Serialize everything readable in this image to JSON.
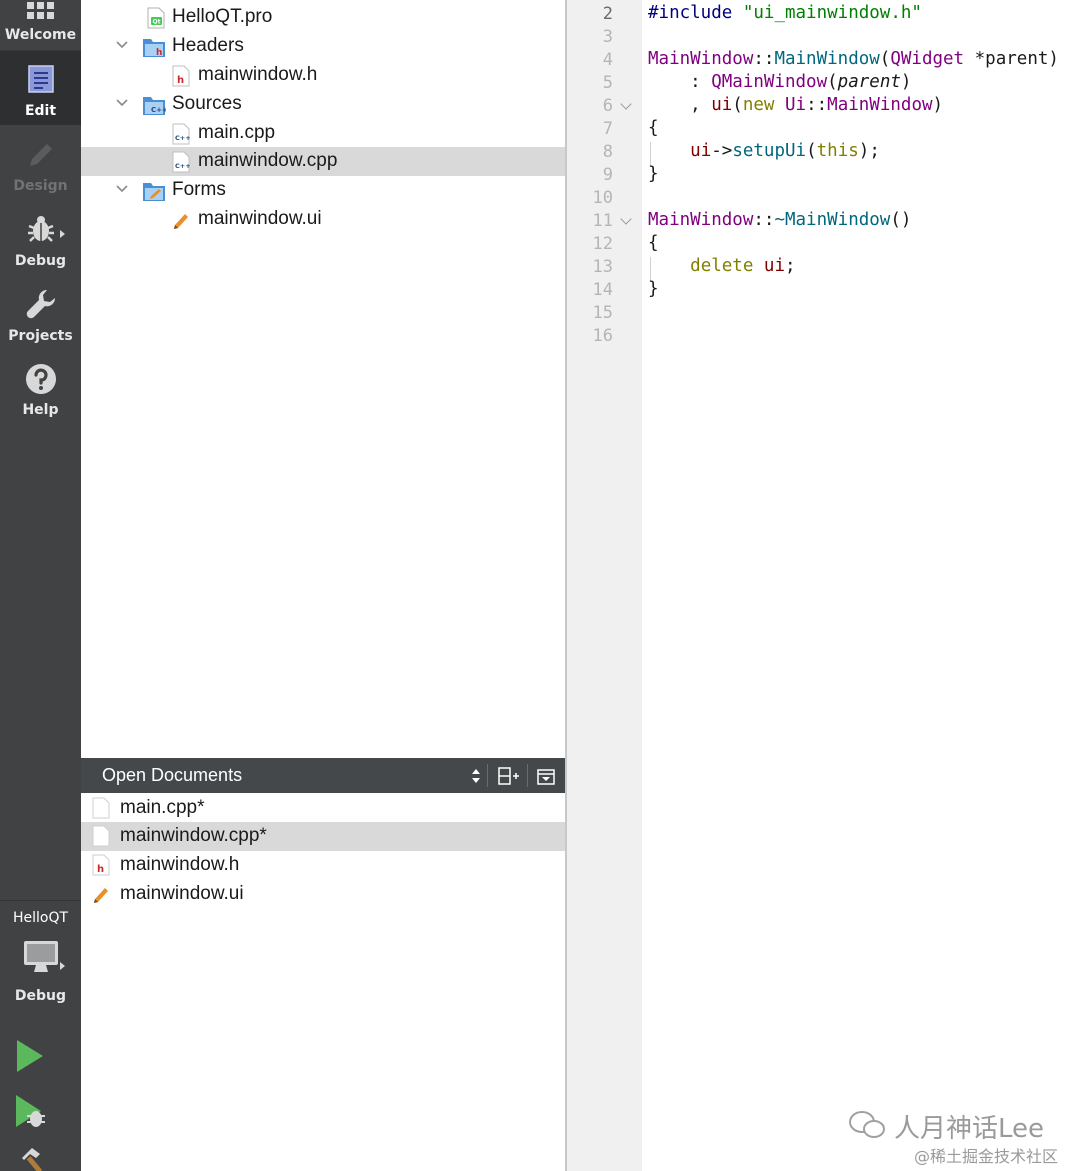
{
  "sidebar": {
    "modes": [
      {
        "label": "Welcome",
        "icon": "welcome-grid-icon"
      },
      {
        "label": "Edit",
        "icon": "edit-document-icon",
        "active": true
      },
      {
        "label": "Design",
        "icon": "design-pencil-icon",
        "disabled": true
      },
      {
        "label": "Debug",
        "icon": "debug-bug-icon"
      },
      {
        "label": "Projects",
        "icon": "projects-wrench-icon"
      },
      {
        "label": "Help",
        "icon": "help-question-icon"
      }
    ],
    "kit": {
      "project": "HelloQT",
      "build_config": "Debug",
      "icon": "monitor-icon"
    },
    "actions": [
      {
        "name": "run",
        "icon": "run-triangle-icon"
      },
      {
        "name": "start-debugging",
        "icon": "run-debug-icon"
      },
      {
        "name": "build",
        "icon": "build-hammer-icon"
      }
    ],
    "colors": {
      "background": "#404244",
      "active": "#2d2f31"
    }
  },
  "project_tree": {
    "items": [
      {
        "label": "HelloQT.pro",
        "icon": "qt-project-file-icon"
      },
      {
        "label": "Headers",
        "icon": "headers-folder-icon",
        "expanded": true
      },
      {
        "label": "mainwindow.h",
        "icon": "header-file-icon"
      },
      {
        "label": "Sources",
        "icon": "sources-folder-icon",
        "expanded": true
      },
      {
        "label": "main.cpp",
        "icon": "cpp-file-icon"
      },
      {
        "label": "mainwindow.cpp",
        "icon": "cpp-file-icon",
        "selected": true
      },
      {
        "label": "Forms",
        "icon": "forms-folder-icon",
        "expanded": true
      },
      {
        "label": "mainwindow.ui",
        "icon": "ui-form-file-icon"
      }
    ]
  },
  "open_documents": {
    "title": "Open Documents",
    "items": [
      {
        "label": "main.cpp*",
        "icon": "blank-file-icon"
      },
      {
        "label": "mainwindow.cpp*",
        "icon": "blank-file-icon",
        "selected": true
      },
      {
        "label": "mainwindow.h",
        "icon": "header-file-icon"
      },
      {
        "label": "mainwindow.ui",
        "icon": "ui-form-file-icon"
      }
    ]
  },
  "editor": {
    "line_numbers": [
      "2",
      "3",
      "4",
      "5",
      "6",
      "7",
      "8",
      "9",
      "10",
      "11",
      "12",
      "13",
      "14",
      "15",
      "16"
    ],
    "current_line": "2",
    "code": {
      "l2": {
        "directive": "#include",
        "header": "\"ui_mainwindow.h\""
      },
      "l4": {
        "cls": "MainWindow",
        "scope": "::",
        "ctor": "MainWindow",
        "open": "(",
        "param_type": "QWidget",
        "param": " *parent",
        "close": ")"
      },
      "l5": {
        "prefix": "    : ",
        "base": "QMainWindow",
        "open": "(",
        "arg": "parent",
        "close": ")"
      },
      "l6": {
        "prefix": "    , ",
        "member": "ui",
        "open": "(",
        "kw": "new",
        "sp": " ",
        "ns": "Ui",
        "scope": "::",
        "cls": "MainWindow",
        "close": ")"
      },
      "l7": "{",
      "l8": {
        "prefix": "    ",
        "member": "ui",
        "arrow": "->",
        "fn": "setupUi",
        "open": "(",
        "kw": "this",
        "close": ");"
      },
      "l9": "}",
      "l11": {
        "cls": "MainWindow",
        "scope": "::",
        "dtor": "~MainWindow",
        "parens": "()"
      },
      "l12": "{",
      "l13": {
        "prefix": "    ",
        "kw": "delete",
        "sp": " ",
        "member": "ui",
        "semi": ";"
      },
      "l14": "}"
    }
  },
  "watermark": {
    "line1": "人月神话Lee",
    "line2": "@稀土掘金技术社区"
  }
}
